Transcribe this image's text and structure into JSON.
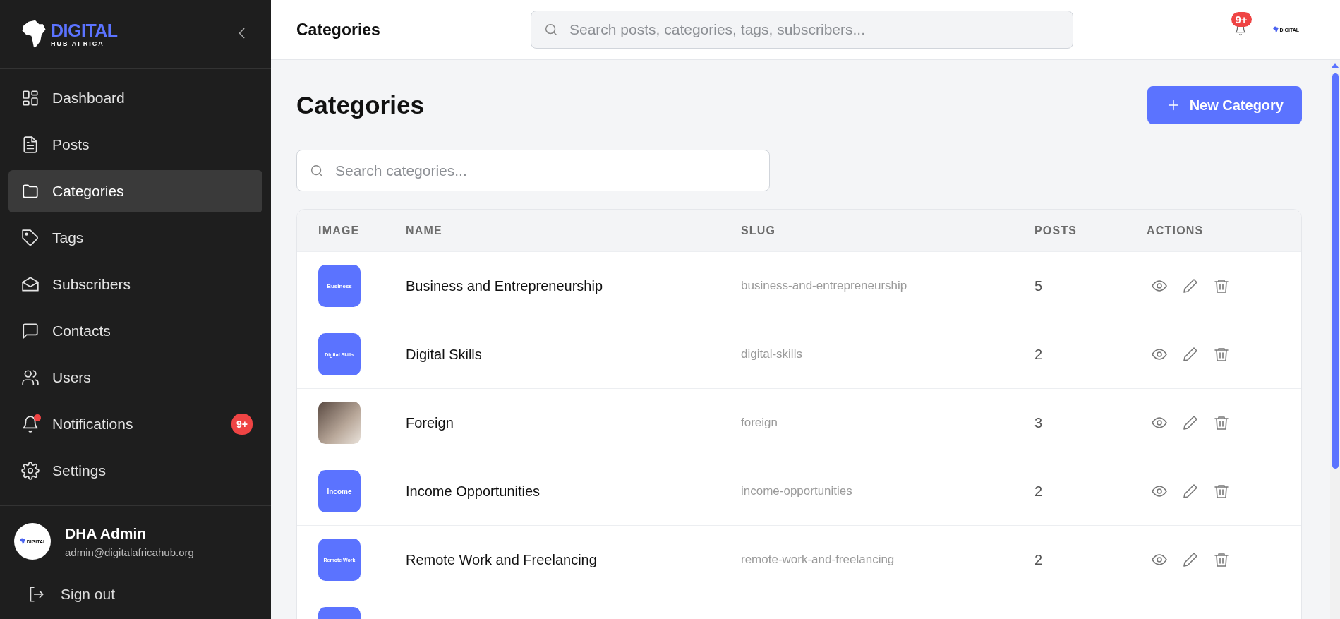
{
  "sidebar": {
    "logo": {
      "title": "DIGITAL",
      "subtitle": "HUB AFRICA"
    },
    "items": [
      {
        "label": "Dashboard",
        "selected": false
      },
      {
        "label": "Posts",
        "selected": false
      },
      {
        "label": "Categories",
        "selected": true
      },
      {
        "label": "Tags",
        "selected": false
      },
      {
        "label": "Subscribers",
        "selected": false
      },
      {
        "label": "Contacts",
        "selected": false
      },
      {
        "label": "Users",
        "selected": false
      },
      {
        "label": "Notifications",
        "selected": false,
        "dot": true,
        "badge": "9+"
      },
      {
        "label": "Settings",
        "selected": false
      }
    ],
    "user": {
      "logo_text": "DIGITAL",
      "name": "DHA Admin",
      "email": "admin@digitalafricahub.org"
    },
    "sign_out": "Sign out"
  },
  "header": {
    "title": "Categories",
    "search_placeholder": "Search posts, categories, tags, subscribers...",
    "notification_badge": "9+",
    "logo_text": "DIGITAL"
  },
  "page": {
    "title": "Categories",
    "new_button": "New Category",
    "search_placeholder": "Search categories...",
    "table": {
      "columns": [
        "IMAGE",
        "NAME",
        "SLUG",
        "POSTS",
        "ACTIONS"
      ],
      "rows": [
        {
          "image": {
            "kind": "tile",
            "label": "Business"
          },
          "name": "Business and Entrepreneurship",
          "slug": "business-and-entrepreneurship",
          "posts": "5"
        },
        {
          "image": {
            "kind": "tile",
            "label": "Digital Skills"
          },
          "name": "Digital Skills",
          "slug": "digital-skills",
          "posts": "2"
        },
        {
          "image": {
            "kind": "photo"
          },
          "name": "Foreign",
          "slug": "foreign",
          "posts": "3"
        },
        {
          "image": {
            "kind": "tile",
            "label": "Income"
          },
          "name": "Income Opportunities",
          "slug": "income-opportunities",
          "posts": "2"
        },
        {
          "image": {
            "kind": "tile",
            "label": "Remote Work"
          },
          "name": "Remote Work and Freelancing",
          "slug": "remote-work-and-freelancing",
          "posts": "2"
        },
        {
          "image": {
            "kind": "tile"
          }
        }
      ]
    }
  }
}
